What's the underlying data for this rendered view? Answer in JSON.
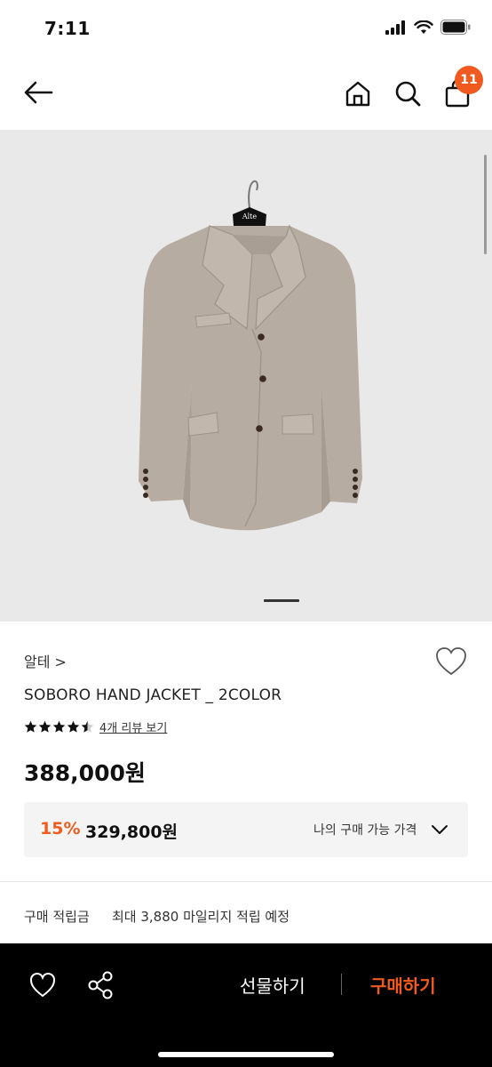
{
  "status": {
    "time": "7:11"
  },
  "nav": {
    "cart_count": "11"
  },
  "product": {
    "image_alt": "SOBORO HAND JACKET",
    "hanger_tag": "Alte",
    "brand": "알테 >",
    "name": "SOBORO HAND JACKET _ 2COLOR",
    "rating": 4.5,
    "review_link": "4개 리뷰 보기",
    "price": "388,000원"
  },
  "discount": {
    "rate": "15%",
    "price": "329,800원",
    "label": "나의 구매 가능 가격"
  },
  "points": {
    "label": "구매 적립금",
    "value": "최대 3,880 마일리지 적립 예정"
  },
  "bottom_bar": {
    "gift": "선물하기",
    "buy": "구매하기"
  },
  "colors": {
    "accent": "#f05a1e",
    "hero_bg": "#e9e9e9",
    "jacket": "#b6aca1"
  }
}
